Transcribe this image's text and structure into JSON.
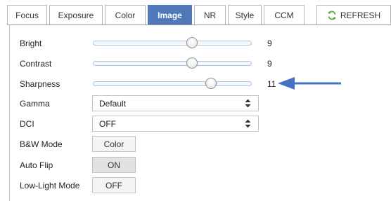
{
  "tabs": [
    {
      "label": "Focus",
      "active": false
    },
    {
      "label": "Exposure",
      "active": false
    },
    {
      "label": "Color",
      "active": false
    },
    {
      "label": "Image",
      "active": true
    },
    {
      "label": "NR",
      "active": false
    },
    {
      "label": "Style",
      "active": false
    },
    {
      "label": "CCM",
      "active": false
    }
  ],
  "refresh": {
    "label": "REFRESH",
    "icon": "refresh-icon"
  },
  "sliders": [
    {
      "label": "Bright",
      "value": "9",
      "position": 0.62
    },
    {
      "label": "Contrast",
      "value": "9",
      "position": 0.62
    },
    {
      "label": "Sharpness",
      "value": "11",
      "position": 0.74
    }
  ],
  "selects": [
    {
      "label": "Gamma",
      "value": "Default"
    },
    {
      "label": "DCI",
      "value": "OFF"
    }
  ],
  "toggles": [
    {
      "label": "B&W Mode",
      "value": "Color",
      "state": "off"
    },
    {
      "label": "Auto Flip",
      "value": "ON",
      "state": "on"
    },
    {
      "label": "Low-Light Mode",
      "value": "OFF",
      "state": "off"
    }
  ],
  "annotation": {
    "icon": "arrow-left-icon",
    "color": "#4472c4"
  },
  "colors": {
    "accent": "#4f79b9",
    "slider_border": "#a9c4e4"
  }
}
